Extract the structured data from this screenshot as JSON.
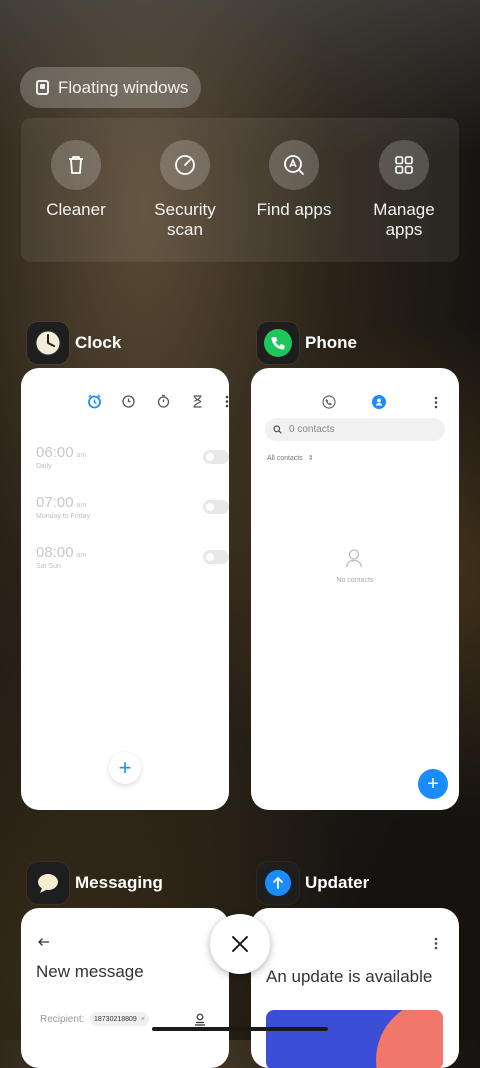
{
  "floating_windows": {
    "label": "Floating windows",
    "icon": "floating-window-icon"
  },
  "quick_actions": [
    {
      "label": "Cleaner",
      "icon": "trash-icon"
    },
    {
      "label": "Security scan",
      "icon": "shield-scan-icon"
    },
    {
      "label": "Find apps",
      "icon": "app-search-icon"
    },
    {
      "label": "Manage apps",
      "icon": "grid-icon"
    }
  ],
  "apps": {
    "clock": {
      "name": "Clock",
      "alarms": [
        {
          "time": "06:00",
          "ampm": "am",
          "repeat": "Daily"
        },
        {
          "time": "07:00",
          "ampm": "am",
          "repeat": "Monday to Friday"
        },
        {
          "time": "08:00",
          "ampm": "am",
          "repeat": "Sat Sun"
        }
      ]
    },
    "phone": {
      "name": "Phone",
      "search_placeholder": "0 contacts",
      "filter": "All contacts",
      "empty_text": "No contacts"
    },
    "messaging": {
      "name": "Messaging",
      "title": "New message",
      "recipient_label": "Recipient:",
      "recipient_chip": "18730218809"
    },
    "updater": {
      "name": "Updater",
      "title": "An update is available"
    }
  },
  "colors": {
    "accent": "#1a8cff",
    "phone_green": "#1ec75b",
    "updater_blue": "#1a8cff"
  }
}
